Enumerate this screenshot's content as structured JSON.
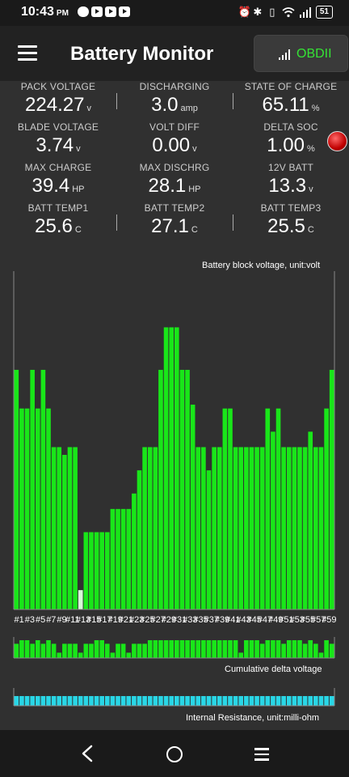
{
  "status_bar": {
    "time": "10:43",
    "ampm": "PM",
    "battery_level": "51",
    "icons": [
      "chat-icon",
      "youtube-icon",
      "youtube-icon",
      "youtube-icon",
      "alarm-icon",
      "bluetooth-icon",
      "vibrate-icon",
      "wifi-icon",
      "signal-icon",
      "battery-icon"
    ]
  },
  "header": {
    "title": "Battery Monitor",
    "obd_label": "OBDII",
    "obd_color": "#35e335"
  },
  "metrics": [
    {
      "label": "PACK VOLTAGE",
      "value": "224.27",
      "unit": "v"
    },
    {
      "label": "DISCHARGING",
      "value": "3.0",
      "unit": "amp"
    },
    {
      "label": "STATE OF CHARGE",
      "value": "65.11",
      "unit": "%"
    },
    {
      "label": "BLADE VOLTAGE",
      "value": "3.74",
      "unit": "v"
    },
    {
      "label": "VOLT DIFF",
      "value": "0.00",
      "unit": "v"
    },
    {
      "label": "DELTA SOC",
      "value": "1.00",
      "unit": "%"
    },
    {
      "label": "MAX CHARGE",
      "value": "39.4",
      "unit": "HP"
    },
    {
      "label": "MAX DISCHRG",
      "value": "28.1",
      "unit": "HP"
    },
    {
      "label": "12V BATT",
      "value": "13.3",
      "unit": "v"
    },
    {
      "label": "BATT TEMP1",
      "value": "25.6",
      "unit": "C"
    },
    {
      "label": "BATT TEMP2",
      "value": "27.1",
      "unit": "C"
    },
    {
      "label": "BATT TEMP3",
      "value": "25.5",
      "unit": "C"
    }
  ],
  "chart_data": [
    {
      "type": "bar",
      "title": "Battery block voltage, unit:volt",
      "categories": [
        "#1",
        "#2",
        "#3",
        "#4",
        "#5",
        "#6",
        "#7",
        "#8",
        "#9",
        "#10",
        "#11",
        "#12",
        "#13",
        "#14",
        "#15",
        "#16",
        "#17",
        "#18",
        "#19",
        "#20",
        "#21",
        "#22",
        "#23",
        "#24",
        "#25",
        "#26",
        "#27",
        "#28",
        "#29",
        "#30",
        "#31",
        "#32",
        "#33",
        "#34",
        "#35",
        "#36",
        "#37",
        "#38",
        "#39",
        "#40",
        "#41",
        "#42",
        "#43",
        "#44",
        "#45",
        "#46",
        "#47",
        "#48",
        "#49",
        "#50",
        "#51",
        "#52",
        "#53",
        "#54",
        "#55",
        "#56",
        "#57",
        "#58",
        "#59",
        "#60"
      ],
      "tick_labels": [
        "#1",
        "#3",
        "#5",
        "#7",
        "#9",
        "#11",
        "#13",
        "#15",
        "#17",
        "#19",
        "#21",
        "#23",
        "#25",
        "#27",
        "#29",
        "#31",
        "#33",
        "#35",
        "#37",
        "#39",
        "#41",
        "#43",
        "#45",
        "#47",
        "#49",
        "#51",
        "#53",
        "#55",
        "#57",
        "#59"
      ],
      "values": [
        0.62,
        0.52,
        0.52,
        0.62,
        0.52,
        0.62,
        0.52,
        0.42,
        0.42,
        0.4,
        0.42,
        0.42,
        0.05,
        0.2,
        0.2,
        0.2,
        0.2,
        0.2,
        0.26,
        0.26,
        0.26,
        0.26,
        0.3,
        0.36,
        0.42,
        0.42,
        0.42,
        0.62,
        0.73,
        0.73,
        0.73,
        0.62,
        0.62,
        0.53,
        0.42,
        0.42,
        0.36,
        0.42,
        0.42,
        0.52,
        0.52,
        0.42,
        0.42,
        0.42,
        0.42,
        0.42,
        0.42,
        0.52,
        0.46,
        0.52,
        0.42,
        0.42,
        0.42,
        0.42,
        0.42,
        0.46,
        0.42,
        0.42,
        0.52,
        0.62
      ],
      "ylim": [
        0,
        0.8
      ],
      "highlight_index": 12,
      "color": "#19e619",
      "highlight_color": "#d8ffd8"
    },
    {
      "type": "bar",
      "title": "Cumulative delta voltage",
      "values": [
        0.8,
        1.0,
        1.0,
        0.8,
        1.0,
        0.8,
        1.0,
        0.8,
        0.3,
        0.8,
        0.8,
        0.8,
        0.3,
        0.8,
        0.8,
        1.0,
        1.0,
        0.8,
        0.3,
        0.8,
        0.8,
        0.3,
        0.8,
        0.8,
        0.8,
        1.0,
        1.0,
        1.0,
        1.0,
        1.0,
        1.0,
        1.0,
        1.0,
        1.0,
        1.0,
        1.0,
        1.0,
        1.0,
        1.0,
        1.0,
        1.0,
        1.0,
        0.3,
        1.0,
        1.0,
        1.0,
        0.8,
        1.0,
        1.0,
        1.0,
        0.8,
        1.0,
        1.0,
        1.0,
        0.8,
        1.0,
        0.8,
        0.3,
        1.0,
        0.8
      ],
      "ylim": [
        0,
        1.0
      ],
      "color": "#19e619"
    },
    {
      "type": "bar",
      "title": "Internal Resistance, unit:milli-ohm",
      "values": [
        1,
        1,
        1,
        1,
        1,
        1,
        1,
        1,
        1,
        1,
        1,
        1,
        1,
        1,
        1,
        1,
        1,
        1,
        1,
        1,
        1,
        1,
        1,
        1,
        1,
        1,
        1,
        1,
        1,
        1,
        1,
        1,
        1,
        1,
        1,
        1,
        1,
        1,
        1,
        1,
        1,
        1,
        1,
        1,
        1,
        1,
        1,
        1,
        1,
        1,
        1,
        1,
        1,
        1,
        1,
        1,
        1,
        1,
        1,
        1
      ],
      "ylim": [
        0,
        1
      ],
      "color": "#29d6e6"
    }
  ],
  "nav": {
    "icons": [
      "back-icon",
      "home-icon",
      "recents-icon"
    ]
  }
}
